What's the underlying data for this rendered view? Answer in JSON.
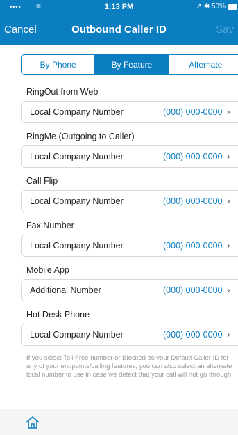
{
  "status_bar": {
    "signal": "••••",
    "wifi": "≡",
    "time": "1:13 PM",
    "right": "↗ ✱ 50%"
  },
  "nav": {
    "cancel": "Cancel",
    "title": "Outbound Caller ID",
    "save": "Sav"
  },
  "tabs": [
    {
      "label": "By Phone",
      "active": false
    },
    {
      "label": "By Feature",
      "active": true
    },
    {
      "label": "Alternate",
      "active": false
    }
  ],
  "features": [
    {
      "label": "RingOut from Web",
      "value_label": "Local Company Number",
      "number": "(000) 000-0000"
    },
    {
      "label": "RingMe (Outgoing to Caller)",
      "value_label": "Local Company Number",
      "number": "(000) 000-0000"
    },
    {
      "label": "Call Flip",
      "value_label": "Local Company Number",
      "number": "(000) 000-0000"
    },
    {
      "label": "Fax Number",
      "value_label": "Local Company Number",
      "number": "(000) 000-0000"
    },
    {
      "label": "Mobile App",
      "value_label": "Additional Number",
      "number": "(000) 000-0000"
    },
    {
      "label": "Hot Desk Phone",
      "value_label": "Local Company Number",
      "number": "(000) 000-0000"
    }
  ],
  "chevron": "›",
  "footnote": "If you select Toll Free number or Blocked as your Default Caller ID for any of your endpoints/calling features, you can also select an alternate local number to use in case we detect that your call will not go through.",
  "colors": {
    "accent": "#0b7dc1",
    "header_bg": "#0b7dc1",
    "footnote_text": "#9a9a9a"
  },
  "icons": {
    "home": "home-icon",
    "chevron": "chevron-right-icon"
  }
}
